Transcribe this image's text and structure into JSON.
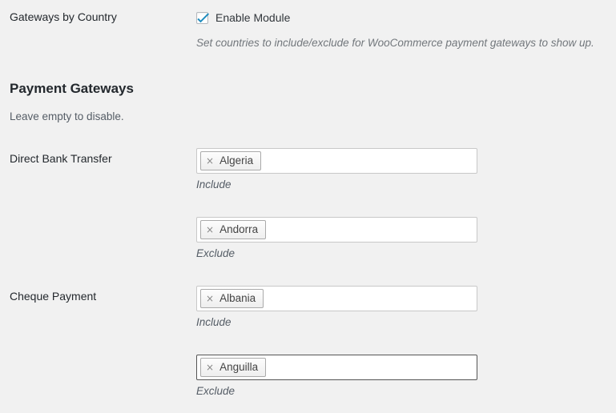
{
  "module_row": {
    "label": "Gateways by Country",
    "checkbox_label": "Enable Module",
    "checked": true,
    "description": "Set countries to include/exclude for WooCommerce payment gateways to show up."
  },
  "section": {
    "title": "Payment Gateways",
    "subtitle": "Leave empty to disable."
  },
  "gateways": [
    {
      "label": "Direct Bank Transfer",
      "include": {
        "helper": "Include",
        "tags": [
          {
            "remove": "×",
            "name": "Algeria"
          }
        ],
        "focused": false
      },
      "exclude": {
        "helper": "Exclude",
        "tags": [
          {
            "remove": "×",
            "name": "Andorra"
          }
        ],
        "focused": false
      }
    },
    {
      "label": "Cheque Payment",
      "include": {
        "helper": "Include",
        "tags": [
          {
            "remove": "×",
            "name": "Albania"
          }
        ],
        "focused": false
      },
      "exclude": {
        "helper": "Exclude",
        "tags": [
          {
            "remove": "×",
            "name": "Anguilla"
          }
        ],
        "focused": true
      }
    }
  ],
  "colors": {
    "background": "#f1f1f1",
    "text": "#23282d",
    "muted": "#555d66",
    "checkbox_accent": "#1e8cbe",
    "field_border": "#c8c8c8",
    "field_border_focus": "#555555",
    "chip_border": "#aaaaaa"
  }
}
